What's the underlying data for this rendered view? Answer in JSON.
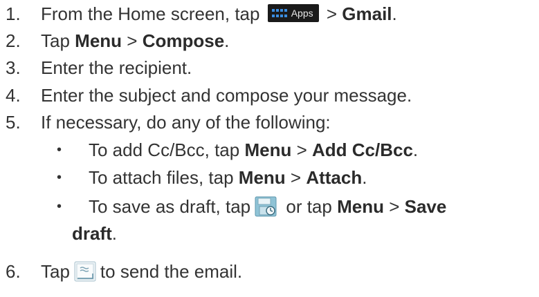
{
  "steps": [
    {
      "num": "1.",
      "a": "From the Home screen, tap",
      "chip_label": "Apps",
      "b": " > ",
      "bold1": "Gmail",
      "end": "."
    },
    {
      "num": "2.",
      "a": "Tap ",
      "bold1": "Menu",
      "b": " > ",
      "bold2": "Compose",
      "end": "."
    },
    {
      "num": "3.",
      "a": "Enter the recipient."
    },
    {
      "num": "4.",
      "a": "Enter the subject and compose your message."
    },
    {
      "num": "5.",
      "a": "If necessary, do any of the following:"
    },
    {
      "num": "6.",
      "a": "Tap",
      "b": "to send the email."
    }
  ],
  "sub_items": [
    {
      "bullet": "•",
      "a": "To add Cc/Bcc, tap ",
      "bold1": "Menu",
      "b": " > ",
      "bold2": "Add Cc/Bcc",
      "end": "."
    },
    {
      "bullet": "•",
      "a": "To attach files, tap ",
      "bold1": "Menu",
      "b": " > ",
      "bold2": "Attach",
      "end": "."
    },
    {
      "bullet": "•",
      "a": "To save as draft, tap",
      "b": " or tap ",
      "bold1": "Menu",
      "c": " > ",
      "bold2": "Save",
      "line2_bold": "draft",
      "end": "."
    }
  ],
  "icons": {
    "apps": "apps-grid-icon",
    "save_draft": "save-draft-icon",
    "send": "send-email-icon"
  }
}
